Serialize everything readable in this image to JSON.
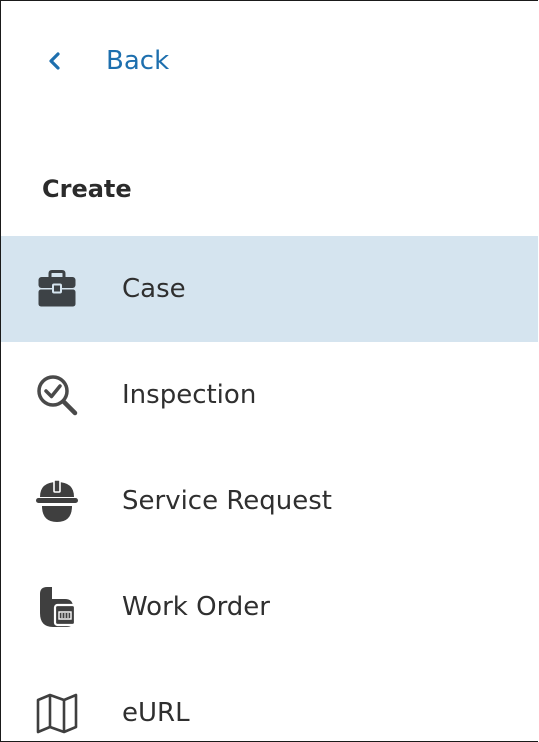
{
  "nav": {
    "back_label": "Back",
    "back_icon": "chevron-left-icon",
    "accent": "#1d6fae"
  },
  "section": {
    "title": "Create"
  },
  "menu": {
    "selected_bg": "#d5e4ef",
    "items": [
      {
        "label": "Case",
        "icon": "briefcase-icon",
        "selected": true
      },
      {
        "label": "Inspection",
        "icon": "inspection-check-magnifier-icon",
        "selected": false
      },
      {
        "label": "Service Request",
        "icon": "hard-hat-icon",
        "selected": false
      },
      {
        "label": "Work Order",
        "icon": "work-order-icon",
        "selected": false
      },
      {
        "label": "eURL",
        "icon": "map-icon",
        "selected": false
      }
    ]
  }
}
